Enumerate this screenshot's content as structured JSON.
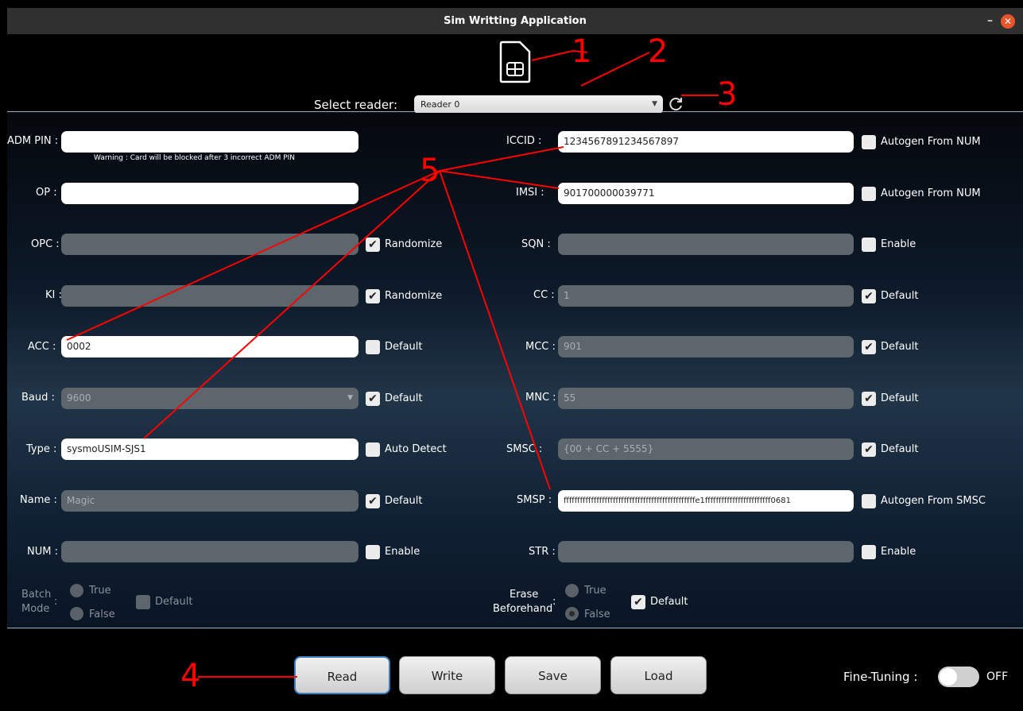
{
  "window": {
    "title": "Sim Writting Application",
    "minimize": "–",
    "close": "✕"
  },
  "header": {
    "reader_label": "Select reader:",
    "reader_value": "Reader 0",
    "sim_icon": "sim-card-icon",
    "refresh_icon": "refresh-icon"
  },
  "left": {
    "adm_pin": {
      "label": "ADM PIN :",
      "value": "",
      "warning": "Warning : Card will be blocked after 3 incorrect ADM PIN"
    },
    "op": {
      "label": "OP :",
      "value": ""
    },
    "opc": {
      "label": "OPC :",
      "value": "",
      "check_label": "Randomize",
      "checked": true
    },
    "ki": {
      "label": "KI :",
      "value": "",
      "check_label": "Randomize",
      "checked": true
    },
    "acc": {
      "label": "ACC :",
      "value": "0002",
      "check_label": "Default",
      "checked": false
    },
    "baud": {
      "label": "Baud :",
      "value": "9600",
      "check_label": "Default",
      "checked": true
    },
    "type": {
      "label": "Type :",
      "value": "sysmoUSIM-SJS1",
      "check_label": "Auto Detect",
      "checked": false
    },
    "name": {
      "label": "Name :",
      "value": "Magic",
      "check_label": "Default",
      "checked": true
    },
    "num": {
      "label": "NUM :",
      "value": "",
      "check_label": "Enable",
      "checked": false
    },
    "batch": {
      "label_1": "Batch",
      "label_2": "Mode",
      "colon": ":",
      "true_label": "True",
      "false_label": "False",
      "check_label": "Default"
    }
  },
  "right": {
    "iccid": {
      "label": "ICCID :",
      "value": "1234567891234567897",
      "check_label": "Autogen From NUM",
      "checked": false
    },
    "imsi": {
      "label": "IMSI :",
      "value": "901700000039771",
      "check_label": "Autogen From NUM",
      "checked": false
    },
    "sqn": {
      "label": "SQN :",
      "value": "",
      "check_label": "Enable",
      "checked": false
    },
    "cc": {
      "label": "CC :",
      "value": "1",
      "check_label": "Default",
      "checked": true
    },
    "mcc": {
      "label": "MCC :",
      "value": "901",
      "check_label": "Default",
      "checked": true
    },
    "mnc": {
      "label": "MNC :",
      "value": "55",
      "check_label": "Default",
      "checked": true
    },
    "smsc": {
      "label": "SMSC :",
      "value": "{00 + CC + 5555}",
      "check_label": "Default",
      "checked": true
    },
    "smsp": {
      "label": "SMSP :",
      "value": "ffffffffffffffffffffffffffffffffffffffffffffffffe1ffffffffffffffffffffffff0681",
      "check_label": "Autogen From SMSC",
      "checked": false
    },
    "str": {
      "label": "STR :",
      "value": "",
      "check_label": "Enable",
      "checked": false
    },
    "erase": {
      "label_1": "Erase",
      "label_2": "Beforehand",
      "colon": ":",
      "true_label": "True",
      "false_label": "False",
      "check_label": "Default",
      "checked": true
    }
  },
  "footer": {
    "buttons": [
      "Read",
      "Write",
      "Save",
      "Load"
    ],
    "fine_tuning_label": "Fine-Tuning :",
    "fine_tuning_state": "OFF"
  },
  "annotations": [
    "1",
    "2",
    "3",
    "4",
    "5"
  ],
  "colors": {
    "annotation": "#ff0000",
    "close": "#e9542b",
    "focus": "#3d7fbf"
  }
}
